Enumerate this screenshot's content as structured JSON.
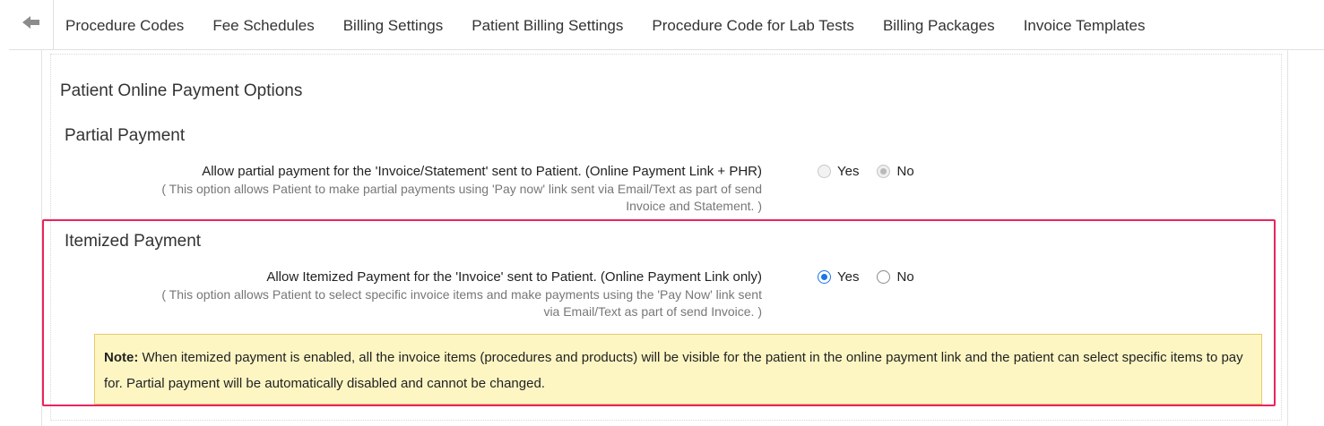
{
  "nav": {
    "back_icon": "back-arrow-icon",
    "items": [
      "Procedure Codes",
      "Fee Schedules",
      "Billing Settings",
      "Patient Billing Settings",
      "Procedure Code for Lab Tests",
      "Billing Packages",
      "Invoice Templates"
    ]
  },
  "content": {
    "title": "Patient Online Payment Options",
    "partial": {
      "heading": "Partial Payment",
      "label": "Allow partial payment for the 'Invoice/Statement' sent to Patient. (Online Payment Link + PHR)",
      "help_line1": "( This option allows Patient to make partial payments using 'Pay now' link sent via Email/Text as part of send",
      "help_line2": "Invoice and Statement. )",
      "yes_label": "Yes",
      "no_label": "No",
      "selected": "No",
      "disabled": true
    },
    "itemized": {
      "heading": "Itemized Payment",
      "label": "Allow Itemized Payment for the 'Invoice' sent to Patient. (Online Payment Link only)",
      "help_line1": "( This option allows Patient to select specific invoice items and make payments using the 'Pay Now' link sent",
      "help_line2": "via Email/Text as part of send Invoice. )",
      "yes_label": "Yes",
      "no_label": "No",
      "selected": "Yes",
      "disabled": false
    },
    "note": {
      "prefix": "Note:",
      "text": " When itemized payment is enabled, all the invoice items (procedures and products) will be visible for the patient in the online payment link and the patient can select specific items to pay for. Partial payment will be automatically disabled and cannot be changed."
    }
  },
  "colors": {
    "highlight_border": "#e8245e",
    "radio_checked": "#1a73e8",
    "note_background": "#fdf6c3"
  }
}
